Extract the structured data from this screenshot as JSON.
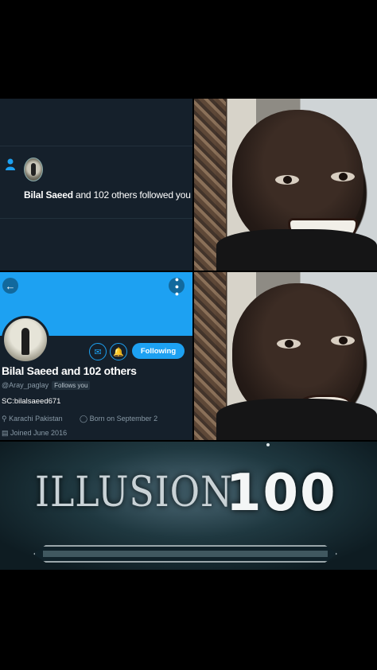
{
  "notification": {
    "name": "Bilal Saeed",
    "rest": " and 102 others followed you"
  },
  "profile": {
    "name": "Bilal Saeed and 102 others",
    "handle": "@Aray_paglay",
    "follows_badge": "Follows you",
    "bio": "SC:bilalsaeed671",
    "location": "Karachi Pakistan",
    "born": "Born on September 2",
    "joined": "Joined June 2016",
    "follow_button": "Following",
    "icons": {
      "back": "arrow-left-icon",
      "more": "more-dots-icon",
      "message": "mail-icon",
      "notify": "bell-icon",
      "location": "location-pin-icon",
      "birthday": "balloon-icon",
      "calendar": "calendar-icon",
      "follower": "person-icon"
    }
  },
  "skill": {
    "word": "ILLUSION",
    "level": "100",
    "progress": 1.0
  },
  "colors": {
    "twitter_blue": "#1da1f2",
    "dark_bg": "#15202b",
    "muted_text": "#8899a6"
  }
}
